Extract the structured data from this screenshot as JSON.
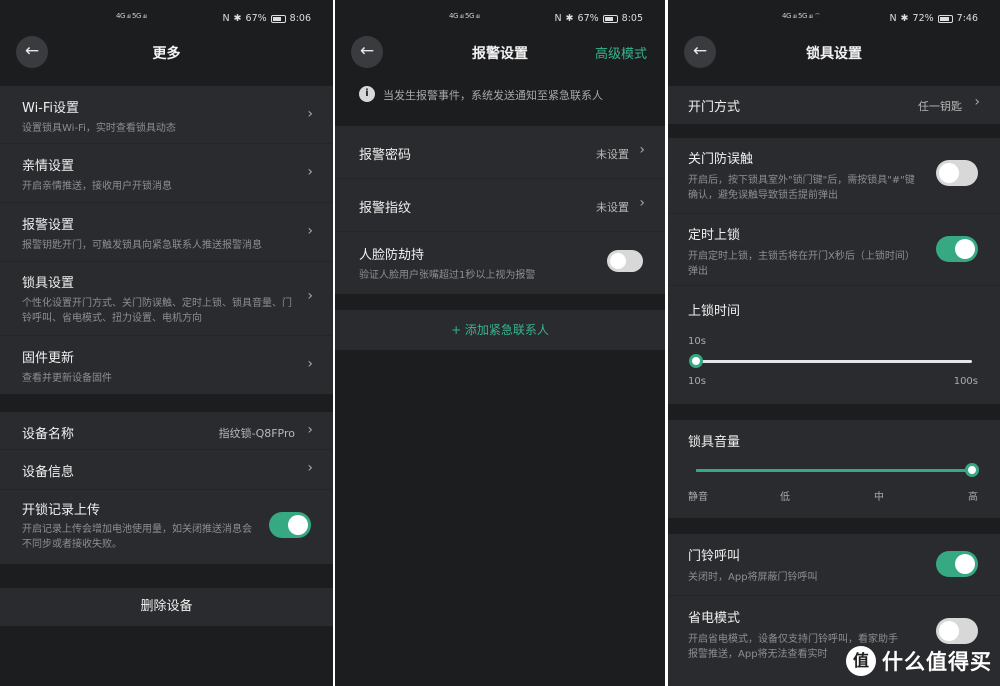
{
  "status": {
    "p1": {
      "signal": "4G ₄ᵢₗ 5G ₄ᵢₗ",
      "battery": "67%",
      "time": "8:06",
      "battery_level": 0.67
    },
    "p2": {
      "signal": "4G ₄ᵢₗ 5G ₄ᵢₗ",
      "battery": "67%",
      "time": "8:05",
      "battery_level": 0.67
    },
    "p3": {
      "signal": "4G ₄ᵢₗ 5G ₄ᵢₗ ⌔",
      "battery": "72%",
      "time": "7:46",
      "battery_level": 0.72
    },
    "icons": [
      "nfc-icon",
      "bluetooth-icon",
      "wifi-icon",
      "battery-icon"
    ]
  },
  "screen1": {
    "title": "更多",
    "menu": [
      {
        "title": "Wi-Fi设置",
        "sub": "设置锁具Wi-Fi，实时查看锁具动态"
      },
      {
        "title": "亲情设置",
        "sub": "开启亲情推送，接收用户开锁消息"
      },
      {
        "title": "报警设置",
        "sub": "报警钥匙开门，可触发锁具向紧急联系人推送报警消息"
      },
      {
        "title": "锁具设置",
        "sub": "个性化设置开门方式、关门防误触、定时上锁、锁具音量、门铃呼叫、省电模式、扭力设置、电机方向"
      },
      {
        "title": "固件更新",
        "sub": "查看并更新设备固件"
      }
    ],
    "device_name_label": "设备名称",
    "device_name_value": "指纹锁-Q8FPro",
    "device_info_label": "设备信息",
    "unlock_upload_title": "开锁记录上传",
    "unlock_upload_sub": "开启记录上传会增加电池使用量，如关闭推送消息会不同步或者接收失败。",
    "unlock_upload_on": true,
    "delete_label": "删除设备"
  },
  "screen2": {
    "title": "报警设置",
    "advanced": "高级模式",
    "info": "当发生报警事件，系统发送通知至紧急联系人",
    "rows": [
      {
        "title": "报警密码",
        "value": "未设置"
      },
      {
        "title": "报警指纹",
        "value": "未设置"
      }
    ],
    "face_title": "人脸防劫持",
    "face_sub": "验证人脸用户张嘴超过1秒以上视为报警",
    "face_on": false,
    "add_contact": "+ 添加紧急联系人"
  },
  "screen3": {
    "title": "锁具设置",
    "open_method_label": "开门方式",
    "open_method_value": "任一钥匙",
    "anti_touch_title": "关门防误触",
    "anti_touch_sub": "开启后，按下锁具室外\"锁门键\"后，需按锁具\"#\"键确认，避免误触导致锁舌提前弹出",
    "anti_touch_on": false,
    "timed_lock_title": "定时上锁",
    "timed_lock_sub": "开启定时上锁，主锁舌将在开门X秒后（上锁时间）弹出",
    "timed_lock_on": true,
    "lock_time_title": "上锁时间",
    "lock_time_value": "10s",
    "lock_time_min": "10s",
    "lock_time_max": "100s",
    "lock_time_fraction": 0,
    "volume_title": "锁具音量",
    "volume_levels": [
      "静音",
      "低",
      "中",
      "高"
    ],
    "volume_fraction": 1,
    "doorbell_title": "门铃呼叫",
    "doorbell_sub": "关闭时，App将屏蔽门铃呼叫",
    "doorbell_on": true,
    "power_title": "省电模式",
    "power_sub_line1": "开启省电模式，设备仅支持门铃呼叫，看家助手",
    "power_sub_line2": "报警推送，App将无法查看实时",
    "power_on": false
  },
  "watermark": {
    "badge": "值",
    "text": "什么值得买"
  }
}
